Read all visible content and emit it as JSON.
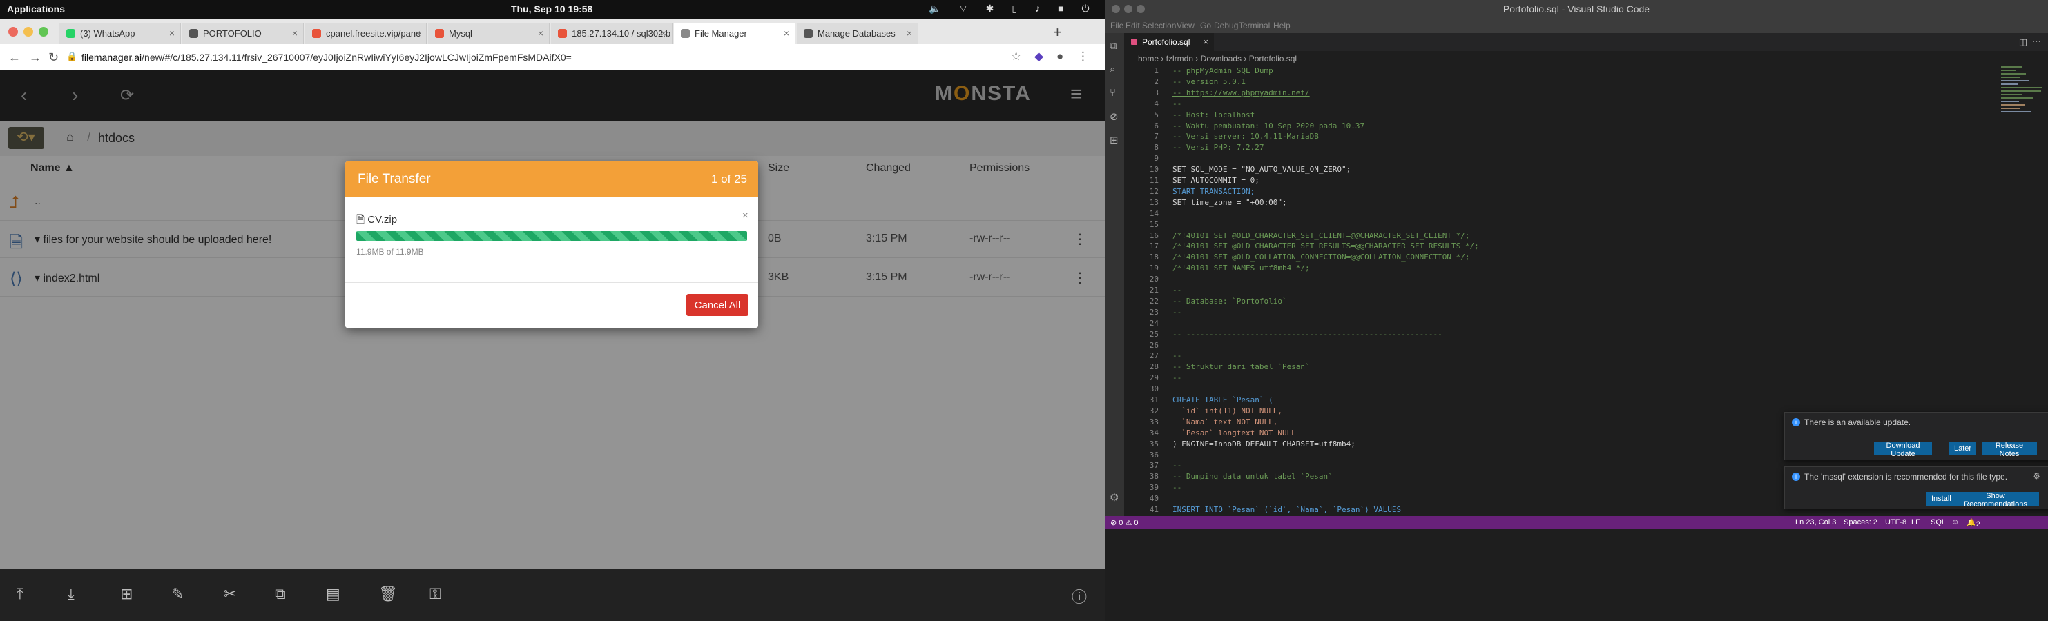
{
  "system": {
    "apps_label": "Applications",
    "clock": "Thu, Sep 10   19:58"
  },
  "browser": {
    "tabs": [
      {
        "label": "(3) WhatsApp",
        "icon_color": "#25d366"
      },
      {
        "label": "PORTOFOLIO",
        "icon_color": "#555555"
      },
      {
        "label": "cpanel.freesite.vip/pane",
        "icon_color": "#e8543b"
      },
      {
        "label": "Mysql",
        "icon_color": "#e8543b"
      },
      {
        "label": "185.27.134.10 / sql302.b",
        "icon_color": "#e8543b"
      },
      {
        "label": "File Manager",
        "icon_color": "#888888"
      },
      {
        "label": "Manage Databases",
        "icon_color": "#555555"
      }
    ],
    "url_host": "filemanager.ai",
    "url_rest": "/new/#/c/185.27.134.11/frsiv_26710007/eyJ0IjoiZnRwIiwiYyI6eyJ2IjowLCJwIjoiZmFpemFsMDAifX0="
  },
  "monsta": {
    "logo_left": "M",
    "logo_o": "O",
    "logo_right": "NSTA",
    "current_folder": "htdocs",
    "columns": {
      "name": "Name",
      "size": "Size",
      "changed": "Changed",
      "permissions": "Permissions"
    },
    "parent_label": "..",
    "files": [
      {
        "name": "files for your website should be uploaded here!",
        "size": "0B",
        "changed": "3:15 PM",
        "permissions": "-rw-r--r--"
      },
      {
        "name": "index2.html",
        "size": "3KB",
        "changed": "3:15 PM",
        "permissions": "-rw-r--r--"
      }
    ]
  },
  "transfer_dialog": {
    "title": "File Transfer",
    "count": "1 of 25",
    "file_name": "CV.zip",
    "progress_text": "11.9MB of 11.9MB",
    "progress_fraction": 1.0,
    "cancel_label": "Cancel All"
  },
  "vscode": {
    "window_title": "Portofolio.sql - Visual Studio Code",
    "menu": [
      "File",
      "Edit",
      "Selection",
      "View",
      "Go",
      "Debug",
      "Terminal",
      "Help"
    ],
    "tab_label": "Portofolio.sql",
    "breadcrumb": "home  ›  fzlrmdn  ›  Downloads  ›  Portofolio.sql",
    "code_lines": [
      {
        "n": "1",
        "t": "-- phpMyAdmin SQL Dump",
        "c": "c-comment"
      },
      {
        "n": "2",
        "t": "-- version 5.0.1",
        "c": "c-comment"
      },
      {
        "n": "3",
        "t": "-- https://www.phpmyadmin.net/",
        "c": "c-link"
      },
      {
        "n": "4",
        "t": "--",
        "c": "c-comment"
      },
      {
        "n": "5",
        "t": "-- Host: localhost",
        "c": "c-comment"
      },
      {
        "n": "6",
        "t": "-- Waktu pembuatan: 10 Sep 2020 pada 10.37",
        "c": "c-comment"
      },
      {
        "n": "7",
        "t": "-- Versi server: 10.4.11-MariaDB",
        "c": "c-comment"
      },
      {
        "n": "8",
        "t": "-- Versi PHP: 7.2.27",
        "c": "c-comment"
      },
      {
        "n": "9",
        "t": "",
        "c": "c-plain"
      },
      {
        "n": "10",
        "t": "SET SQL_MODE = \"NO_AUTO_VALUE_ON_ZERO\";",
        "c": "c-plain"
      },
      {
        "n": "11",
        "t": "SET AUTOCOMMIT = 0;",
        "c": "c-plain"
      },
      {
        "n": "12",
        "t": "START TRANSACTION;",
        "c": "c-kw"
      },
      {
        "n": "13",
        "t": "SET time_zone = \"+00:00\";",
        "c": "c-plain"
      },
      {
        "n": "14",
        "t": "",
        "c": "c-plain"
      },
      {
        "n": "15",
        "t": "",
        "c": "c-plain"
      },
      {
        "n": "16",
        "t": "/*!40101 SET @OLD_CHARACTER_SET_CLIENT=@@CHARACTER_SET_CLIENT */;",
        "c": "c-comment"
      },
      {
        "n": "17",
        "t": "/*!40101 SET @OLD_CHARACTER_SET_RESULTS=@@CHARACTER_SET_RESULTS */;",
        "c": "c-comment"
      },
      {
        "n": "18",
        "t": "/*!40101 SET @OLD_COLLATION_CONNECTION=@@COLLATION_CONNECTION */;",
        "c": "c-comment"
      },
      {
        "n": "19",
        "t": "/*!40101 SET NAMES utf8mb4 */;",
        "c": "c-comment"
      },
      {
        "n": "20",
        "t": "",
        "c": "c-plain"
      },
      {
        "n": "21",
        "t": "--",
        "c": "c-comment"
      },
      {
        "n": "22",
        "t": "-- Database: `Portofolio`",
        "c": "c-comment"
      },
      {
        "n": "23",
        "t": "--",
        "c": "c-comment"
      },
      {
        "n": "24",
        "t": "",
        "c": "c-plain"
      },
      {
        "n": "25",
        "t": "-- --------------------------------------------------------",
        "c": "c-comment"
      },
      {
        "n": "26",
        "t": "",
        "c": "c-plain"
      },
      {
        "n": "27",
        "t": "--",
        "c": "c-comment"
      },
      {
        "n": "28",
        "t": "-- Struktur dari tabel `Pesan`",
        "c": "c-comment"
      },
      {
        "n": "29",
        "t": "--",
        "c": "c-comment"
      },
      {
        "n": "30",
        "t": "",
        "c": "c-plain"
      },
      {
        "n": "31",
        "t": "CREATE TABLE `Pesan` (",
        "c": "c-kw"
      },
      {
        "n": "32",
        "t": "  `id` int(11) NOT NULL,",
        "c": "c-str"
      },
      {
        "n": "33",
        "t": "  `Nama` text NOT NULL,",
        "c": "c-str"
      },
      {
        "n": "34",
        "t": "  `Pesan` longtext NOT NULL",
        "c": "c-str"
      },
      {
        "n": "35",
        "t": ") ENGINE=InnoDB DEFAULT CHARSET=utf8mb4;",
        "c": "c-plain"
      },
      {
        "n": "36",
        "t": "",
        "c": "c-plain"
      },
      {
        "n": "37",
        "t": "--",
        "c": "c-comment"
      },
      {
        "n": "38",
        "t": "-- Dumping data untuk tabel `Pesan`",
        "c": "c-comment"
      },
      {
        "n": "39",
        "t": "--",
        "c": "c-comment"
      },
      {
        "n": "40",
        "t": "",
        "c": "c-plain"
      },
      {
        "n": "41",
        "t": "INSERT INTO `Pesan` (`id`, `Nama`, `Pesan`) VALUES",
        "c": "c-kw"
      }
    ],
    "notifications": [
      {
        "message": "There is an available update.",
        "buttons": [
          "Download Update",
          "Later",
          "Release Notes"
        ]
      },
      {
        "message": "The 'mssql' extension is recommended for this file type.",
        "buttons": [
          "Install",
          "Show Recommendations"
        ]
      }
    ],
    "status": {
      "problems": "⊗ 0 ⚠ 0",
      "position": "Ln 23, Col 3",
      "spaces": "Spaces: 2",
      "encoding": "UTF-8",
      "eol": "LF",
      "language": "SQL",
      "bell": "2"
    },
    "status_color": "#68217a"
  }
}
